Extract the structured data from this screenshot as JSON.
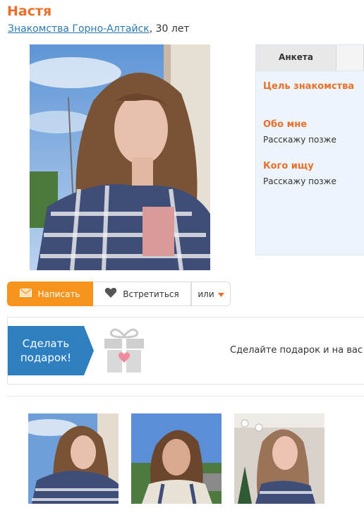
{
  "profile": {
    "name": "Настя",
    "city_link": "Знакомства Горно-Алтайск",
    "age_text": ", 30 лет"
  },
  "panel": {
    "tab_active": "Анкета",
    "sections": [
      {
        "heading": "Цель знакомства",
        "text": ""
      },
      {
        "heading": "Обо мне",
        "text": "Расскажу позже"
      },
      {
        "heading": "Кого ищу",
        "text": "Расскажу позже"
      }
    ]
  },
  "actions": {
    "write": "Написать",
    "meet": "Встретиться",
    "or": "или"
  },
  "gift": {
    "badge_line1": "Сделать",
    "badge_line2": "подарок!",
    "text": "Сделайте подарок и на вас о"
  },
  "colors": {
    "accent": "#e8702a",
    "button_orange": "#f7941d",
    "link": "#2a7ab0",
    "gift_badge": "#2e7fc0"
  },
  "icons": [
    "envelope-icon",
    "heart-icon",
    "caret-down-icon",
    "gift-icon"
  ]
}
